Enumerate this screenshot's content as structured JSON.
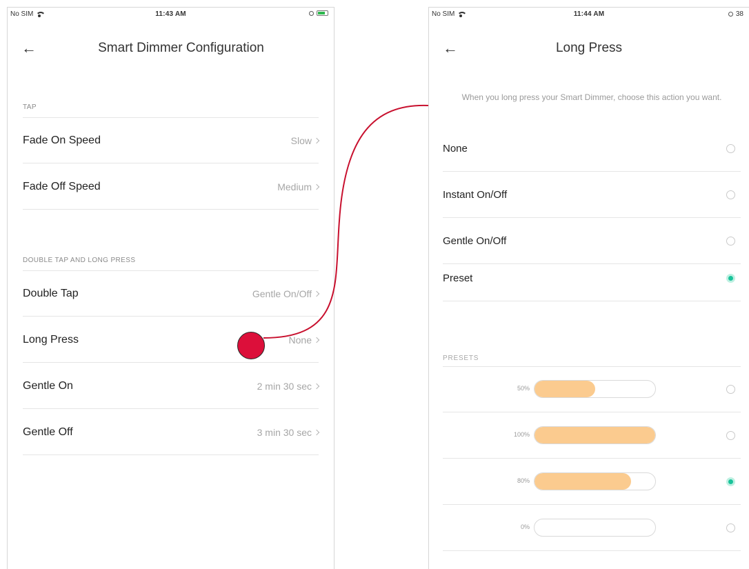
{
  "colors": {
    "accent": "#19c39a",
    "preset_fill": "#fbcb8f",
    "marker": "#dc0f3a",
    "connector": "#c8102e"
  },
  "left_screen": {
    "status": {
      "carrier": "No SIM",
      "time": "11:43 AM"
    },
    "title": "Smart Dimmer Configuration",
    "back_icon": "arrow-left-icon",
    "sections": [
      {
        "header": "TAP",
        "rows": [
          {
            "label": "Fade On Speed",
            "value": "Slow"
          },
          {
            "label": "Fade Off Speed",
            "value": "Medium"
          }
        ]
      },
      {
        "header": "DOUBLE TAP AND LONG PRESS",
        "rows": [
          {
            "label": "Double Tap",
            "value": "Gentle On/Off"
          },
          {
            "label": "Long Press",
            "value": "None"
          },
          {
            "label": "Gentle On",
            "value": "2 min 30 sec"
          },
          {
            "label": "Gentle Off",
            "value": "3 min 30 sec"
          }
        ]
      }
    ]
  },
  "right_screen": {
    "status": {
      "carrier": "No SIM",
      "time": "11:44 AM",
      "battery": "38"
    },
    "title": "Long Press",
    "back_icon": "arrow-left-icon",
    "intro": "When you long press your Smart Dimmer, choose this action you want.",
    "options": [
      {
        "label": "None",
        "selected": false
      },
      {
        "label": "Instant On/Off",
        "selected": false
      },
      {
        "label": "Gentle On/Off",
        "selected": false
      },
      {
        "label": "Preset",
        "selected": true
      }
    ],
    "presets_header": "PRESETS",
    "presets": [
      {
        "label": "50%",
        "level": 50,
        "selected": false
      },
      {
        "label": "100%",
        "level": 100,
        "selected": false
      },
      {
        "label": "80%",
        "level": 80,
        "selected": true
      },
      {
        "label": "0%",
        "level": 0,
        "selected": false
      }
    ]
  }
}
